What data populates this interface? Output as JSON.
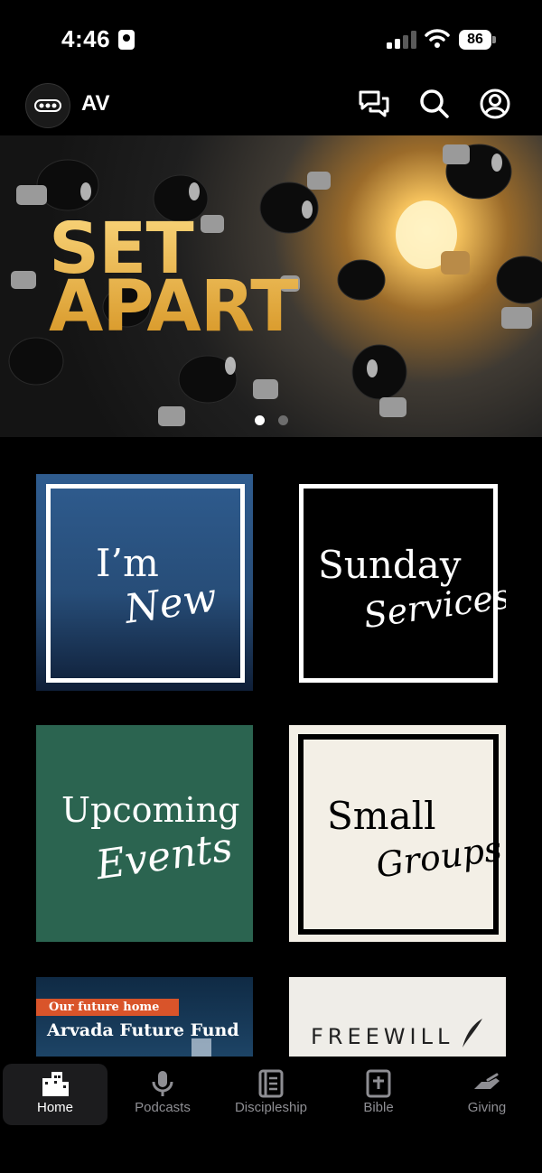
{
  "status": {
    "time": "4:46",
    "battery": "86"
  },
  "header": {
    "title": "AV"
  },
  "hero": {
    "title_line1": "SET",
    "title_line2": "APART"
  },
  "tiles": {
    "new": {
      "serif": "I’m",
      "script": "New"
    },
    "sunday": {
      "serif": "Sunday",
      "script": "Services"
    },
    "events": {
      "serif": "Upcoming",
      "script": "Events"
    },
    "groups": {
      "serif": "Small",
      "script": "Groups"
    },
    "fund": {
      "tag": "Our future home",
      "title": "Arvada Future Fund"
    },
    "freewill": {
      "title": "FREEWILL"
    }
  },
  "tabs": [
    {
      "label": "Home",
      "icon": "buildings-icon"
    },
    {
      "label": "Podcasts",
      "icon": "microphone-icon"
    },
    {
      "label": "Discipleship",
      "icon": "book-icon"
    },
    {
      "label": "Bible",
      "icon": "bible-icon"
    },
    {
      "label": "Giving",
      "icon": "hand-heart-icon"
    }
  ],
  "colors": {
    "accent": "#f0b84a",
    "blue_tile": "#2f5a8c",
    "green_tile": "#2b6450",
    "cream_tile": "#f3efe6"
  }
}
